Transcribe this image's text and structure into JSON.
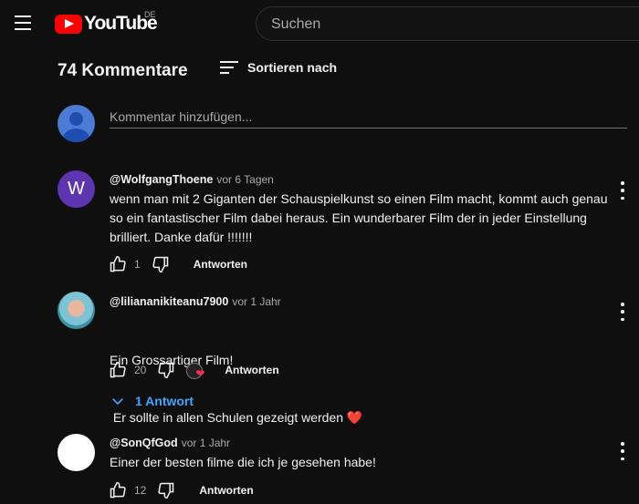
{
  "header": {
    "logo_text": "YouTube",
    "region": "DE",
    "search_placeholder": "Suchen"
  },
  "comments_header": {
    "count_label": "74 Kommentare",
    "sort_label": "Sortieren nach"
  },
  "add_comment": {
    "placeholder": "Kommentar hinzufügen..."
  },
  "comments": [
    {
      "avatar_letter": "W",
      "author": "@WolfgangThoene",
      "time": "vor 6 Tagen",
      "lines": [
        "wenn man mit 2 Giganten der Schauspielkunst so einen Film macht, kommt auch genau",
        "so ein fantastischer Film dabei heraus. Ein wunderbarer Film der in jeder Einstellung",
        "brilliert. Danke dafür !!!!!!!"
      ],
      "likes": "1",
      "reply_label": "Antworten"
    },
    {
      "author": "@liliananikiteanu7900",
      "time": "vor 1 Jahr",
      "lines": [
        "Ein Grossartiger Film!",
        " Er sollte in allen Schulen gezeigt werden ❤️"
      ],
      "likes": "20",
      "reply_label": "Antworten",
      "replies_label": "1 Antwort"
    },
    {
      "author": "@SonQfGod",
      "time": "vor 1 Jahr",
      "lines": [
        "Einer der besten filme die ich je gesehen habe!"
      ],
      "likes": "12",
      "reply_label": "Antworten"
    }
  ],
  "colors": {
    "background": "#0f0f0f",
    "brand_red": "#ff0000",
    "link_blue": "#3ea6ff",
    "avatar_w": "#5e35b1"
  },
  "icons": [
    "menu-icon",
    "youtube-logo-icon",
    "sort-icon",
    "like-icon",
    "dislike-icon",
    "more-icon",
    "chevron-down-icon",
    "heart-icon"
  ]
}
